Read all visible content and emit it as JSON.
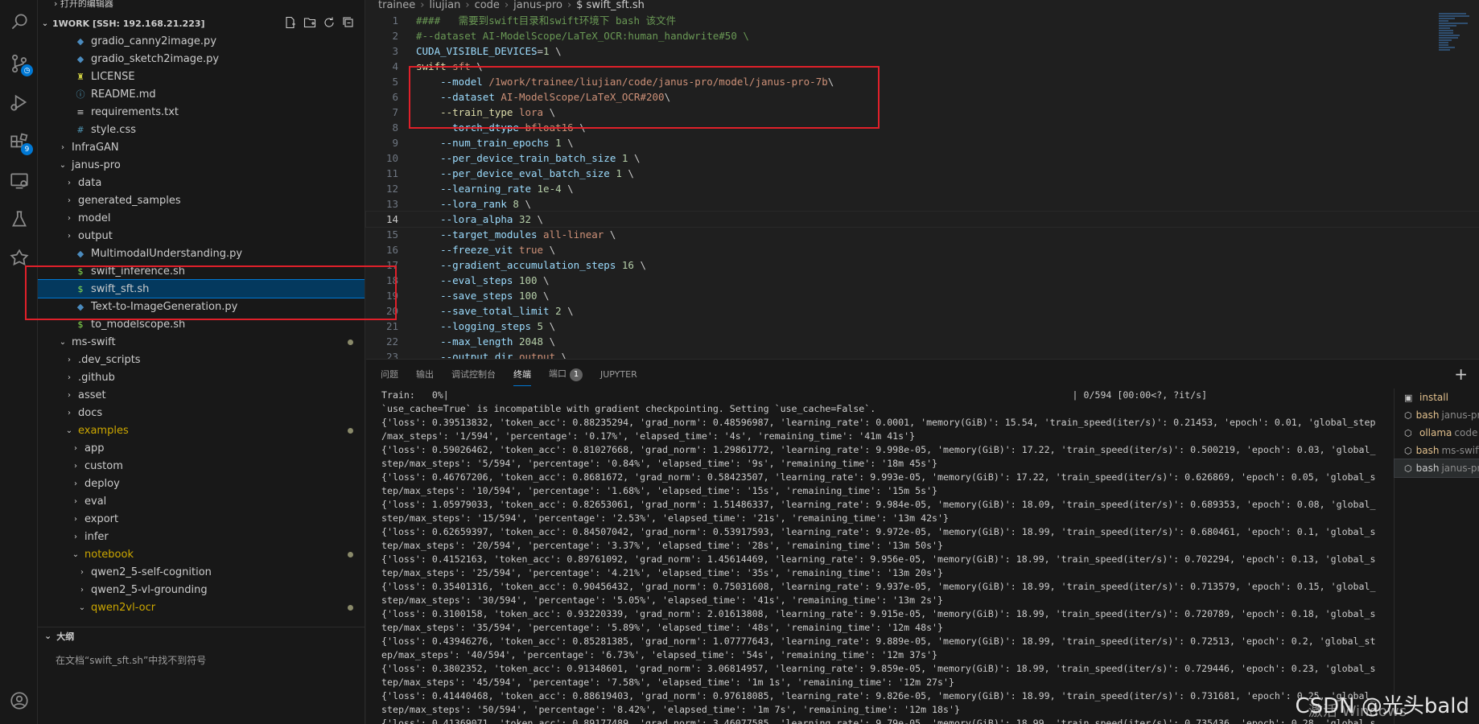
{
  "sidebar": {
    "open_editors_label": "打开的编辑器",
    "workspace_label": "1WORK [SSH: 192.168.21.223]",
    "items": [
      {
        "label": "gradio_canny2image.py",
        "indent": 3,
        "kind": "py"
      },
      {
        "label": "gradio_sketch2image.py",
        "indent": 3,
        "kind": "py"
      },
      {
        "label": "LICENSE",
        "indent": 3,
        "kind": "lic"
      },
      {
        "label": "README.md",
        "indent": 3,
        "kind": "md"
      },
      {
        "label": "requirements.txt",
        "indent": 3,
        "kind": "txt"
      },
      {
        "label": "style.css",
        "indent": 3,
        "kind": "css"
      },
      {
        "label": "InfraGAN",
        "indent": 2,
        "kind": "folder",
        "twisty": "›"
      },
      {
        "label": "janus-pro",
        "indent": 2,
        "kind": "folder",
        "twisty": "⌄"
      },
      {
        "label": "data",
        "indent": 3,
        "kind": "folder",
        "twisty": "›"
      },
      {
        "label": "generated_samples",
        "indent": 3,
        "kind": "folder",
        "twisty": "›"
      },
      {
        "label": "model",
        "indent": 3,
        "kind": "folder",
        "twisty": "›"
      },
      {
        "label": "output",
        "indent": 3,
        "kind": "folder",
        "twisty": "›"
      },
      {
        "label": "MultimodalUnderstanding.py",
        "indent": 3,
        "kind": "py"
      },
      {
        "label": "swift_inference.sh",
        "indent": 3,
        "kind": "sh"
      },
      {
        "label": "swift_sft.sh",
        "indent": 3,
        "kind": "sh",
        "selected": true
      },
      {
        "label": "Text-to-ImageGeneration.py",
        "indent": 3,
        "kind": "py"
      },
      {
        "label": "to_modelscope.sh",
        "indent": 3,
        "kind": "sh"
      },
      {
        "label": "ms-swift",
        "indent": 2,
        "kind": "folder",
        "twisty": "⌄",
        "dot": true
      },
      {
        "label": ".dev_scripts",
        "indent": 3,
        "kind": "folder",
        "twisty": "›"
      },
      {
        "label": ".github",
        "indent": 3,
        "kind": "folder",
        "twisty": "›"
      },
      {
        "label": "asset",
        "indent": 3,
        "kind": "folder",
        "twisty": "›"
      },
      {
        "label": "docs",
        "indent": 3,
        "kind": "folder",
        "twisty": "›"
      },
      {
        "label": "examples",
        "indent": 3,
        "kind": "folder",
        "twisty": "⌄",
        "dot": true,
        "modified": true
      },
      {
        "label": "app",
        "indent": 4,
        "kind": "folder",
        "twisty": "›"
      },
      {
        "label": "custom",
        "indent": 4,
        "kind": "folder",
        "twisty": "›"
      },
      {
        "label": "deploy",
        "indent": 4,
        "kind": "folder",
        "twisty": "›"
      },
      {
        "label": "eval",
        "indent": 4,
        "kind": "folder",
        "twisty": "›"
      },
      {
        "label": "export",
        "indent": 4,
        "kind": "folder",
        "twisty": "›"
      },
      {
        "label": "infer",
        "indent": 4,
        "kind": "folder",
        "twisty": "›"
      },
      {
        "label": "notebook",
        "indent": 4,
        "kind": "folder",
        "twisty": "⌄",
        "dot": true,
        "modified": true
      },
      {
        "label": "qwen2_5-self-cognition",
        "indent": 5,
        "kind": "folder",
        "twisty": "›"
      },
      {
        "label": "qwen2_5-vl-grounding",
        "indent": 5,
        "kind": "folder",
        "twisty": "›"
      },
      {
        "label": "qwen2vl-ocr",
        "indent": 5,
        "kind": "folder",
        "twisty": "⌄",
        "dot": true,
        "modified": true
      }
    ],
    "outline_label": "大纲",
    "outline_message": "在文档“swift_sft.sh”中找不到符号"
  },
  "editor": {
    "breadcrumb": [
      "trainee",
      "liujian",
      "code",
      "janus-pro",
      "$ swift_sft.sh"
    ],
    "current_line": 14,
    "lines": [
      [
        {
          "c": "cm",
          "t": "####   需要到swift目录和swift环境下 bash 该文件"
        }
      ],
      [
        {
          "c": "cm",
          "t": "#--dataset AI-ModelScope/LaTeX_OCR:human_handwrite#50 \\"
        }
      ],
      [
        {
          "c": "vr",
          "t": "CUDA_VISIBLE_DEVICES"
        },
        {
          "c": "tx",
          "t": "="
        },
        {
          "c": "nm",
          "t": "1"
        },
        {
          "c": "tx",
          "t": " \\"
        }
      ],
      [
        {
          "c": "kw",
          "t": "swift"
        },
        {
          "c": "st",
          "t": " sft"
        },
        {
          "c": "tx",
          "t": " \\"
        }
      ],
      [
        {
          "c": "tx",
          "t": "    "
        },
        {
          "c": "op",
          "t": "--model"
        },
        {
          "c": "st",
          "t": " /1work/trainee/liujian/code/janus-pro/model/janus-pro-7b"
        },
        {
          "c": "tx",
          "t": "\\"
        }
      ],
      [
        {
          "c": "tx",
          "t": "    "
        },
        {
          "c": "op",
          "t": "--dataset"
        },
        {
          "c": "st",
          "t": " AI-ModelScope/LaTeX_OCR#200"
        },
        {
          "c": "tx",
          "t": "\\"
        }
      ],
      [
        {
          "c": "tx",
          "t": "    "
        },
        {
          "c": "kw",
          "t": "--train_type"
        },
        {
          "c": "st",
          "t": " lora"
        },
        {
          "c": "tx",
          "t": " \\"
        }
      ],
      [
        {
          "c": "tx",
          "t": "    "
        },
        {
          "c": "op",
          "t": "--torch_dtype"
        },
        {
          "c": "st",
          "t": " bfloat16"
        },
        {
          "c": "tx",
          "t": " \\"
        }
      ],
      [
        {
          "c": "tx",
          "t": "    "
        },
        {
          "c": "op",
          "t": "--num_train_epochs"
        },
        {
          "c": "nm",
          "t": " 1"
        },
        {
          "c": "tx",
          "t": " \\"
        }
      ],
      [
        {
          "c": "tx",
          "t": "    "
        },
        {
          "c": "op",
          "t": "--per_device_train_batch_size"
        },
        {
          "c": "nm",
          "t": " 1"
        },
        {
          "c": "tx",
          "t": " \\"
        }
      ],
      [
        {
          "c": "tx",
          "t": "    "
        },
        {
          "c": "op",
          "t": "--per_device_eval_batch_size"
        },
        {
          "c": "nm",
          "t": " 1"
        },
        {
          "c": "tx",
          "t": " \\"
        }
      ],
      [
        {
          "c": "tx",
          "t": "    "
        },
        {
          "c": "op",
          "t": "--learning_rate"
        },
        {
          "c": "nm",
          "t": " 1e-4"
        },
        {
          "c": "tx",
          "t": " \\"
        }
      ],
      [
        {
          "c": "tx",
          "t": "    "
        },
        {
          "c": "op",
          "t": "--lora_rank"
        },
        {
          "c": "nm",
          "t": " 8"
        },
        {
          "c": "tx",
          "t": " \\"
        }
      ],
      [
        {
          "c": "tx",
          "t": "    "
        },
        {
          "c": "op",
          "t": "--lora_alpha"
        },
        {
          "c": "nm",
          "t": " 32"
        },
        {
          "c": "tx",
          "t": " \\"
        }
      ],
      [
        {
          "c": "tx",
          "t": "    "
        },
        {
          "c": "op",
          "t": "--target_modules"
        },
        {
          "c": "st",
          "t": " all-linear"
        },
        {
          "c": "tx",
          "t": " \\"
        }
      ],
      [
        {
          "c": "tx",
          "t": "    "
        },
        {
          "c": "op",
          "t": "--freeze_vit"
        },
        {
          "c": "st",
          "t": " true"
        },
        {
          "c": "tx",
          "t": " \\"
        }
      ],
      [
        {
          "c": "tx",
          "t": "    "
        },
        {
          "c": "op",
          "t": "--gradient_accumulation_steps"
        },
        {
          "c": "nm",
          "t": " 16"
        },
        {
          "c": "tx",
          "t": " \\"
        }
      ],
      [
        {
          "c": "tx",
          "t": "    "
        },
        {
          "c": "op",
          "t": "--eval_steps"
        },
        {
          "c": "nm",
          "t": " 100"
        },
        {
          "c": "tx",
          "t": " \\"
        }
      ],
      [
        {
          "c": "tx",
          "t": "    "
        },
        {
          "c": "op",
          "t": "--save_steps"
        },
        {
          "c": "nm",
          "t": " 100"
        },
        {
          "c": "tx",
          "t": " \\"
        }
      ],
      [
        {
          "c": "tx",
          "t": "    "
        },
        {
          "c": "op",
          "t": "--save_total_limit"
        },
        {
          "c": "nm",
          "t": " 2"
        },
        {
          "c": "tx",
          "t": " \\"
        }
      ],
      [
        {
          "c": "tx",
          "t": "    "
        },
        {
          "c": "op",
          "t": "--logging_steps"
        },
        {
          "c": "nm",
          "t": " 5"
        },
        {
          "c": "tx",
          "t": " \\"
        }
      ],
      [
        {
          "c": "tx",
          "t": "    "
        },
        {
          "c": "op",
          "t": "--max_length"
        },
        {
          "c": "nm",
          "t": " 2048"
        },
        {
          "c": "tx",
          "t": " \\"
        }
      ],
      [
        {
          "c": "tx",
          "t": "    "
        },
        {
          "c": "op",
          "t": "--output_dir"
        },
        {
          "c": "st",
          "t": " output"
        },
        {
          "c": "tx",
          "t": " \\"
        }
      ]
    ]
  },
  "panel": {
    "tabs": [
      "问题",
      "输出",
      "调试控制台",
      "终端",
      "端口",
      "JUPYTER"
    ],
    "active_tab": "终端",
    "ports_count": "1",
    "terminal_lines": [
      "Train:   0%|                                                                                                               | 0/594 [00:00<?, ?it/s]",
      "`use_cache=True` is incompatible with gradient checkpointing. Setting `use_cache=False`.",
      "{'loss': 0.39513832, 'token_acc': 0.88235294, 'grad_norm': 0.48596987, 'learning_rate': 0.0001, 'memory(GiB)': 15.54, 'train_speed(iter/s)': 0.21453, 'epoch': 0.01, 'global_step",
      "/max_steps': '1/594', 'percentage': '0.17%', 'elapsed_time': '4s', 'remaining_time': '41m 41s'}",
      "{'loss': 0.59026462, 'token_acc': 0.81027668, 'grad_norm': 1.29861772, 'learning_rate': 9.998e-05, 'memory(GiB)': 17.22, 'train_speed(iter/s)': 0.500219, 'epoch': 0.03, 'global_",
      "step/max_steps': '5/594', 'percentage': '0.84%', 'elapsed_time': '9s', 'remaining_time': '18m 45s'}",
      "{'loss': 0.46767206, 'token_acc': 0.8681672, 'grad_norm': 0.58423507, 'learning_rate': 9.993e-05, 'memory(GiB)': 17.22, 'train_speed(iter/s)': 0.626869, 'epoch': 0.05, 'global_s",
      "tep/max_steps': '10/594', 'percentage': '1.68%', 'elapsed_time': '15s', 'remaining_time': '15m 5s'}",
      "{'loss': 1.05979033, 'token_acc': 0.82653061, 'grad_norm': 1.51486337, 'learning_rate': 9.984e-05, 'memory(GiB)': 18.09, 'train_speed(iter/s)': 0.689353, 'epoch': 0.08, 'global_",
      "step/max_steps': '15/594', 'percentage': '2.53%', 'elapsed_time': '21s', 'remaining_time': '13m 42s'}",
      "{'loss': 0.62659397, 'token_acc': 0.84507042, 'grad_norm': 0.53917593, 'learning_rate': 9.972e-05, 'memory(GiB)': 18.99, 'train_speed(iter/s)': 0.680461, 'epoch': 0.1, 'global_s",
      "tep/max_steps': '20/594', 'percentage': '3.37%', 'elapsed_time': '28s', 'remaining_time': '13m 50s'}",
      "{'loss': 0.4152163, 'token_acc': 0.89761092, 'grad_norm': 1.45614469, 'learning_rate': 9.956e-05, 'memory(GiB)': 18.99, 'train_speed(iter/s)': 0.702294, 'epoch': 0.13, 'global_s",
      "tep/max_steps': '25/594', 'percentage': '4.21%', 'elapsed_time': '35s', 'remaining_time': '13m 20s'}",
      "{'loss': 0.35401316, 'token_acc': 0.90456432, 'grad_norm': 0.75031608, 'learning_rate': 9.937e-05, 'memory(GiB)': 18.99, 'train_speed(iter/s)': 0.713579, 'epoch': 0.15, 'global_",
      "step/max_steps': '30/594', 'percentage': '5.05%', 'elapsed_time': '41s', 'remaining_time': '13m 2s'}",
      "{'loss': 0.3100158, 'token_acc': 0.93220339, 'grad_norm': 2.01613808, 'learning_rate': 9.915e-05, 'memory(GiB)': 18.99, 'train_speed(iter/s)': 0.720789, 'epoch': 0.18, 'global_s",
      "tep/max_steps': '35/594', 'percentage': '5.89%', 'elapsed_time': '48s', 'remaining_time': '12m 48s'}",
      "{'loss': 0.43946276, 'token_acc': 0.85281385, 'grad_norm': 1.07777643, 'learning_rate': 9.889e-05, 'memory(GiB)': 18.99, 'train_speed(iter/s)': 0.72513, 'epoch': 0.2, 'global_st",
      "ep/max_steps': '40/594', 'percentage': '6.73%', 'elapsed_time': '54s', 'remaining_time': '12m 37s'}",
      "{'loss': 0.3802352, 'token_acc': 0.91348601, 'grad_norm': 3.06814957, 'learning_rate': 9.859e-05, 'memory(GiB)': 18.99, 'train_speed(iter/s)': 0.729446, 'epoch': 0.23, 'global_s",
      "tep/max_steps': '45/594', 'percentage': '7.58%', 'elapsed_time': '1m 1s', 'remaining_time': '12m 27s'}",
      "{'loss': 0.41440468, 'token_acc': 0.88619403, 'grad_norm': 0.97618085, 'learning_rate': 9.826e-05, 'memory(GiB)': 18.99, 'train_speed(iter/s)': 0.731681, 'epoch': 0.25, 'global_",
      "step/max_steps': '50/594', 'percentage': '8.42%', 'elapsed_time': '1m 7s', 'remaining_time': '12m 18s'}",
      "{'loss': 0.41369071, 'token_acc': 0.89177489, 'grad_norm': 3.46077585, 'learning_rate': 9.79e-05, 'memory(GiB)': 18.99, 'train_speed(iter/s)': 0.735436, 'epoch': 0.28, 'global_s"
    ],
    "terminals": [
      {
        "icon": "task",
        "name": "install",
        "sub": ""
      },
      {
        "icon": "bash",
        "name": "bash",
        "sub": "janus-pro"
      },
      {
        "icon": "bash",
        "name": "ollama",
        "sub": "code"
      },
      {
        "icon": "bash",
        "name": "bash",
        "sub": "ms-swift"
      },
      {
        "icon": "bash",
        "name": "bash",
        "sub": "janus-pro",
        "selected": true
      }
    ]
  },
  "watermark": "CSDN @光头bald",
  "os_watermark": "激活 Windows",
  "colors": {
    "accent": "#0078d4",
    "annotation_red": "#e0202a",
    "modified": "#cca700"
  }
}
